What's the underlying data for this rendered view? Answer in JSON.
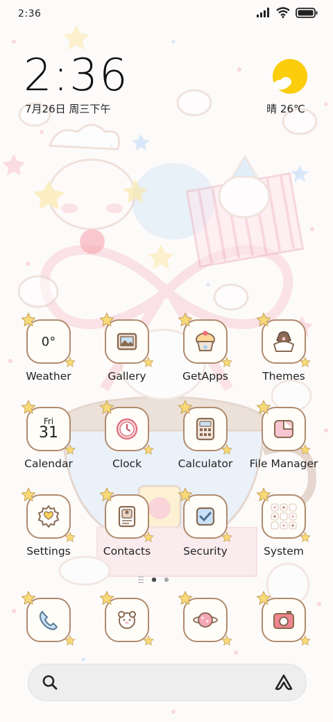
{
  "status_bar": {
    "time": "2:36",
    "icons": [
      "signal-icon",
      "wifi-icon",
      "battery-icon"
    ]
  },
  "clock_widget": {
    "time": "2:36",
    "date": "7月26日 周三下午"
  },
  "weather_widget": {
    "condition_icon": "sun-cloud-icon",
    "text": "晴 26℃"
  },
  "apps": [
    {
      "label": "Weather",
      "icon": "weather-icon",
      "icon_text": "0°"
    },
    {
      "label": "Gallery",
      "icon": "gallery-icon"
    },
    {
      "label": "GetApps",
      "icon": "getapps-icon"
    },
    {
      "label": "Themes",
      "icon": "themes-icon"
    },
    {
      "label": "Calendar",
      "icon": "calendar-icon",
      "day": "Fri",
      "date": "31"
    },
    {
      "label": "Clock",
      "icon": "clock-icon"
    },
    {
      "label": "Calculator",
      "icon": "calculator-icon"
    },
    {
      "label": "File Manager",
      "icon": "file-manager-icon"
    },
    {
      "label": "Settings",
      "icon": "settings-icon"
    },
    {
      "label": "Contacts",
      "icon": "contacts-icon"
    },
    {
      "label": "Security",
      "icon": "security-icon"
    },
    {
      "label": "System",
      "icon": "system-folder-icon"
    }
  ],
  "dock": [
    {
      "icon": "phone-icon"
    },
    {
      "icon": "messages-icon"
    },
    {
      "icon": "browser-icon"
    },
    {
      "icon": "camera-icon"
    }
  ],
  "page_indicator": {
    "pages": 2,
    "current": 1
  },
  "search_bar": {
    "left_icon": "search-icon",
    "right_icon": "assistant-icon"
  },
  "colors": {
    "tile_border": "#b08a6c",
    "star": "#f7d978",
    "pink": "#f4c6cf",
    "sun": "#fbcd0a"
  }
}
